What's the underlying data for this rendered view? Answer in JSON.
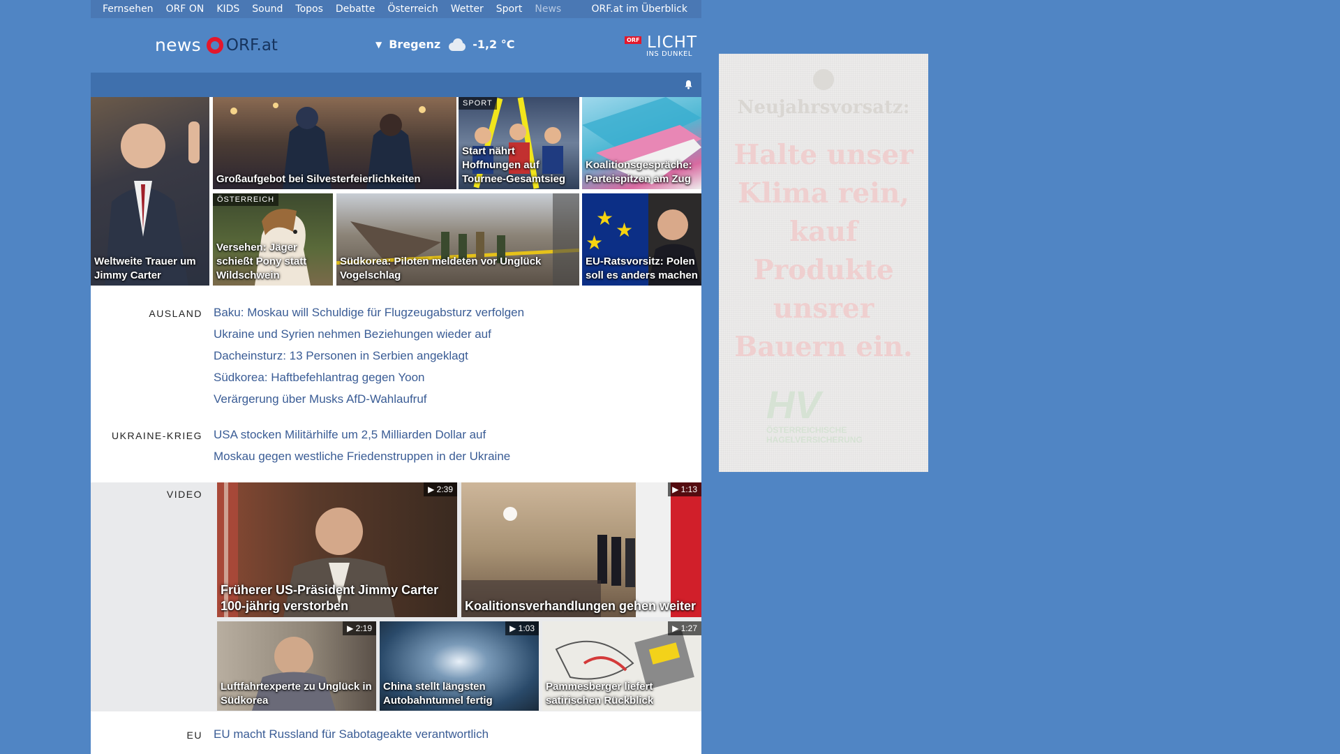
{
  "topnav": {
    "items": [
      "Fernsehen",
      "ORF ON",
      "KIDS",
      "Sound",
      "Topos",
      "Debatte",
      "Österreich",
      "Wetter",
      "Sport",
      "News"
    ],
    "overview": "ORF.at im Überblick"
  },
  "header": {
    "logo_news": "news",
    "logo_orf": "ORF.at",
    "weather_location": "Bregenz",
    "weather_temp": "-1,2 °C",
    "campaign_badge": "ORF",
    "campaign_title": "LICHT",
    "campaign_sub": "INS DUNKEL"
  },
  "colors": {
    "page_bg": "#5085c4",
    "nav_bg": "#4a78b4",
    "bar_bg": "#3f70ad",
    "headline": "#3a5c95",
    "orf_red": "#e4172b"
  },
  "top_tiles": [
    {
      "caption": "Weltweite Trauer um Jimmy Carter",
      "tag": ""
    },
    {
      "caption": "Großaufgebot bei Silvesterfeierlichkeiten",
      "tag": ""
    },
    {
      "caption": "Start nährt Hoffnungen auf Tournee-Gesamtsieg",
      "tag": "SPORT"
    },
    {
      "caption": "Koalitionsgespräche: Parteispitzen am Zug",
      "tag": ""
    },
    {
      "caption": "Versehen: Jäger schießt Pony statt Wildschwein",
      "tag": "ÖSTERREICH"
    },
    {
      "caption": "Südkorea: Piloten meldeten vor Unglück Vogelschlag",
      "tag": ""
    },
    {
      "caption": "EU-Ratsvorsitz: Polen soll es anders machen",
      "tag": ""
    }
  ],
  "sections": {
    "ausland": {
      "label": "AUSLAND",
      "headlines": [
        "Baku: Moskau will Schuldige für Flugzeugabsturz verfolgen",
        "Ukraine und Syrien nehmen Beziehungen wieder auf",
        "Dacheinsturz: 13 Personen in Serbien angeklagt",
        "Südkorea: Haftbefehlantrag gegen Yoon",
        "Verärgerung über Musks AfD-Wahlaufruf"
      ]
    },
    "ukraine": {
      "label": "UKRAINE-KRIEG",
      "headlines": [
        "USA stocken Militärhilfe um 2,5 Milliarden Dollar auf",
        "Moskau gegen westliche Friedenstruppen in der Ukraine"
      ]
    },
    "video": {
      "label": "VIDEO",
      "items": [
        {
          "caption": "Früherer US-Präsident Jimmy Carter 100-jährig verstorben",
          "duration": "2:39"
        },
        {
          "caption": "Koalitionsverhandlungen gehen weiter",
          "duration": "1:13"
        },
        {
          "caption": "Luftfahrtexperte zu Unglück in Südkorea",
          "duration": "2:19"
        },
        {
          "caption": "China stellt längsten Autobahntunnel fertig",
          "duration": "1:03"
        },
        {
          "caption": "Pammesberger liefert satirischen Rückblick",
          "duration": "1:27"
        }
      ]
    },
    "eu": {
      "label": "EU",
      "headlines": [
        "EU macht Russland für Sabotageakte verantwortlich"
      ]
    }
  },
  "ad": {
    "title": "Neujahrsvorsatz:",
    "body": "Halte unser Klima rein, kauf Produkte unsrer Bauern ein.",
    "logo": "HV",
    "logo_sub": "ÖSTERREICHISCHE HAGELVERSICHERUNG"
  }
}
